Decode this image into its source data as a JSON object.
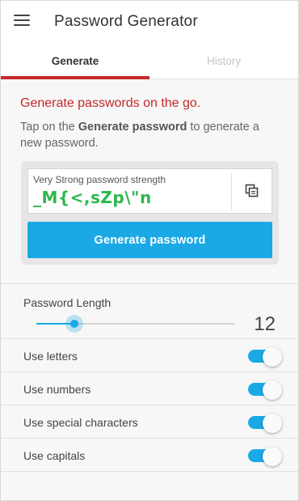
{
  "app": {
    "title": "Password Generator",
    "accent_color": "#c62828",
    "primary_color": "#1ba9e6",
    "strength_color": "#2db84b"
  },
  "tabs": [
    {
      "label": "Generate",
      "active": true
    },
    {
      "label": "History",
      "active": false
    }
  ],
  "intro": {
    "heading": "Generate passwords on the go.",
    "text_before": "Tap on the ",
    "text_bold": "Generate password",
    "text_after": " to generate a new password."
  },
  "generator": {
    "strength_label": "Very Strong password strength",
    "password": "_M{<,sZp\\\"n",
    "copy_icon": "copy-icon",
    "generate_label": "Generate password"
  },
  "settings": {
    "length_label": "Password Length",
    "length_value": "12",
    "slider_fraction": 0.19,
    "options": [
      {
        "label": "Use letters",
        "enabled": true
      },
      {
        "label": "Use numbers",
        "enabled": true
      },
      {
        "label": "Use special characters",
        "enabled": true
      },
      {
        "label": "Use capitals",
        "enabled": true
      }
    ]
  }
}
